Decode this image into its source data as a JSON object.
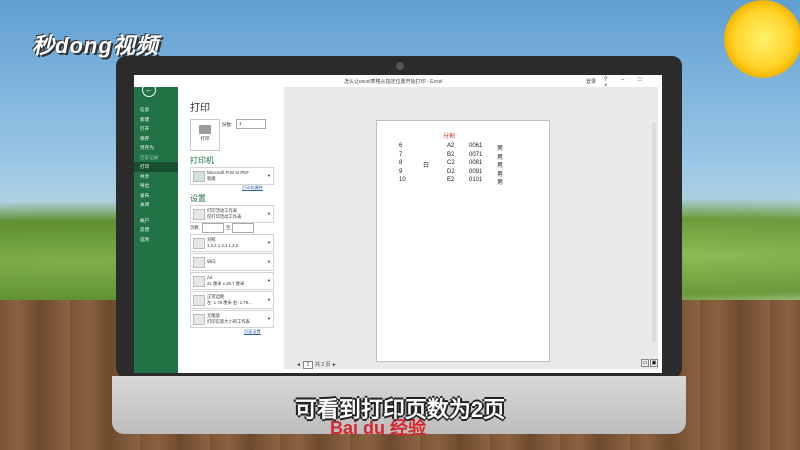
{
  "logo_text": "秒dong视频",
  "window": {
    "title": "怎么让excel表格从指定位置开始打印 - Excel",
    "login": "登录",
    "controls": "? – □ ×"
  },
  "sidebar": {
    "items": [
      {
        "label": "信息",
        "state": "normal"
      },
      {
        "label": "新建",
        "state": "normal"
      },
      {
        "label": "打开",
        "state": "normal"
      },
      {
        "label": "保存",
        "state": "normal"
      },
      {
        "label": "另存为",
        "state": "normal"
      },
      {
        "label": "历史记录",
        "state": "dim"
      },
      {
        "label": "打印",
        "state": "active"
      },
      {
        "label": "共享",
        "state": "normal"
      },
      {
        "label": "导出",
        "state": "normal"
      },
      {
        "label": "发布",
        "state": "normal"
      },
      {
        "label": "关闭",
        "state": "normal"
      },
      {
        "label": "帐户",
        "state": "gap"
      },
      {
        "label": "反馈",
        "state": "normal"
      },
      {
        "label": "选项",
        "state": "normal"
      }
    ]
  },
  "print": {
    "heading": "打印",
    "print_button": "打印",
    "copies_label": "份数:",
    "copies_value": "1",
    "printer_heading": "打印机",
    "printer_name": "Microsoft Print to PDF",
    "printer_status": "就绪",
    "printer_props_link": "打印机属性",
    "settings_heading": "设置",
    "what_to_print": "打印活动工作表",
    "what_to_print_desc": "仅打印活动工作表",
    "pages_label": "页数:",
    "pages_to": "至",
    "collate": "对照",
    "collate_desc": "1,2,3   1,2,3   1,2,3",
    "orientation": "纵向",
    "paper": "A4",
    "paper_desc": "21 厘米 x 29.7 厘米",
    "margins": "正常边距",
    "margins_desc": "左: 1.78 厘米   右: 1.78...",
    "scaling": "无缩放",
    "scaling_desc": "打印实际大小的工作表",
    "page_setup_link": "页面设置"
  },
  "preview": {
    "title": "分割",
    "rows": [
      {
        "n": "6",
        "mid": "",
        "code": "A2",
        "num": "0061",
        "sex": "男"
      },
      {
        "n": "7",
        "mid": "",
        "code": "B2",
        "num": "0071",
        "sex": "男"
      },
      {
        "n": "8",
        "mid": "白",
        "code": "C2",
        "num": "0081",
        "sex": "男"
      },
      {
        "n": "9",
        "mid": "",
        "code": "D2",
        "num": "0091",
        "sex": "男"
      },
      {
        "n": "10",
        "mid": "",
        "code": "E2",
        "num": "0101",
        "sex": "男"
      }
    ],
    "current_page": "2",
    "total_pages": "共 2 页"
  },
  "watermark": "Bai du 经验",
  "subtitle": "可看到打印页数为2页"
}
